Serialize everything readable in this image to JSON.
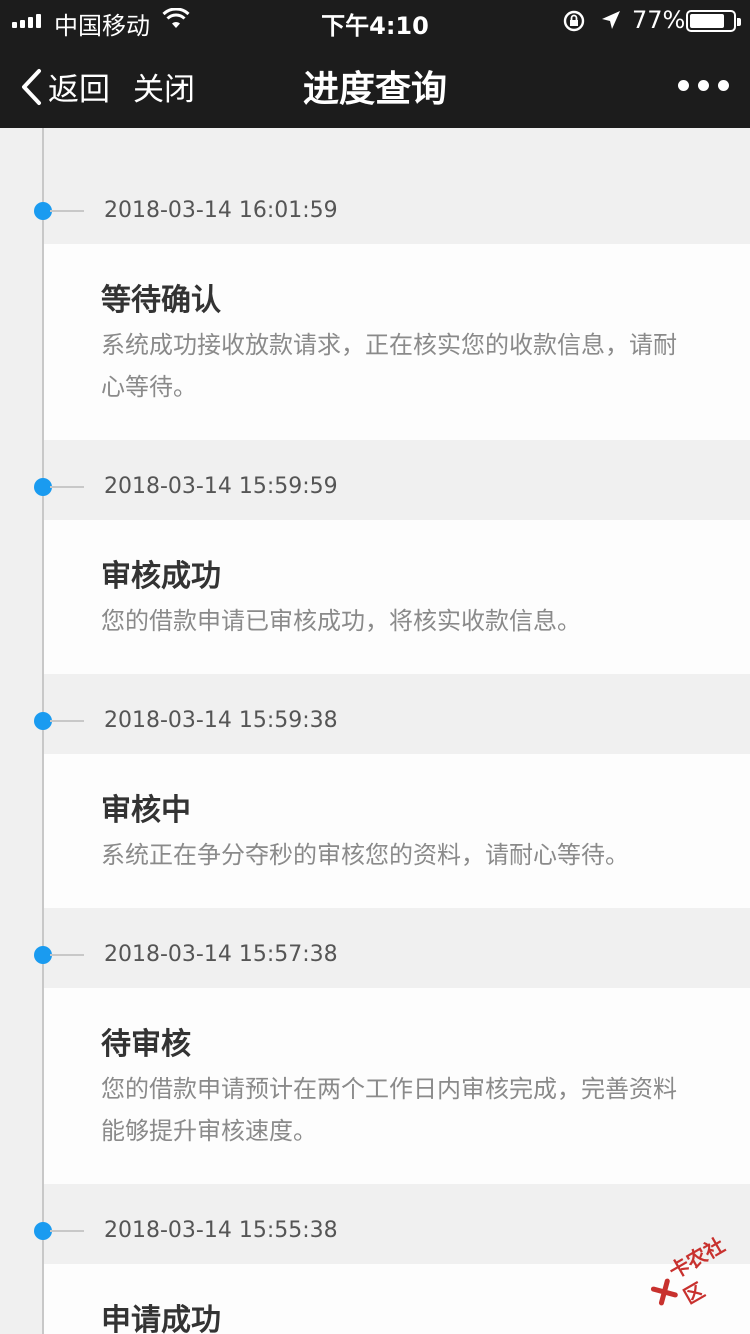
{
  "status_bar": {
    "carrier": "中国移动",
    "time": "下午4:10",
    "battery_percent": "77%",
    "battery_level": 0.77
  },
  "nav": {
    "back_label": "返回",
    "close_label": "关闭",
    "title": "进度查询"
  },
  "events": [
    {
      "timestamp": "2018-03-14 16:01:59",
      "title": "等待确认",
      "description": "系统成功接收放款请求，正在核实您的收款信息，请耐心等待。"
    },
    {
      "timestamp": "2018-03-14 15:59:59",
      "title": "审核成功",
      "description": "您的借款申请已审核成功，将核实收款信息。"
    },
    {
      "timestamp": "2018-03-14 15:59:38",
      "title": "审核中",
      "description": "系统正在争分夺秒的审核您的资料，请耐心等待。"
    },
    {
      "timestamp": "2018-03-14 15:57:38",
      "title": "待审核",
      "description": "您的借款申请预计在两个工作日内审核完成，完善资料能够提升审核速度。"
    },
    {
      "timestamp": "2018-03-14 15:55:38",
      "title": "申请成功",
      "description": ""
    }
  ],
  "watermark": {
    "text": "卡农社区"
  },
  "colors": {
    "header_bg": "#1c1c1c",
    "timeline_dot": "#1a9bf0",
    "page_bg": "#f0f0f0",
    "watermark": "#c8312e"
  }
}
